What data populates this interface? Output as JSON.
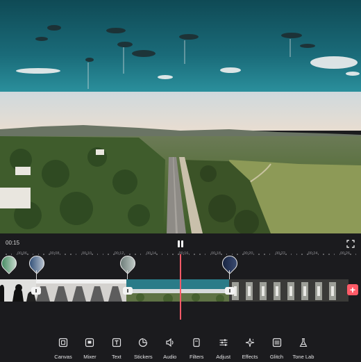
{
  "player": {
    "current_time": "00:15",
    "state": "paused"
  },
  "ruler": {
    "labels": [
      "00:06",
      "00:08",
      "00:10",
      "00:12",
      "00:14",
      "00:16",
      "00:18",
      "00:20",
      "00:22",
      "00:24",
      "00:26"
    ]
  },
  "timeline": {
    "markers": [
      "effect-marker-1",
      "effect-marker-2",
      "effect-marker-3",
      "effect-marker-4"
    ]
  },
  "toolbar": {
    "items": [
      {
        "label": "Canvas",
        "icon": "canvas-icon"
      },
      {
        "label": "Mixer",
        "icon": "mixer-icon"
      },
      {
        "label": "Text",
        "icon": "text-icon"
      },
      {
        "label": "Stickers",
        "icon": "stickers-icon"
      },
      {
        "label": "Audio",
        "icon": "audio-icon"
      },
      {
        "label": "Filters",
        "icon": "filters-icon"
      },
      {
        "label": "Adjust",
        "icon": "adjust-icon"
      },
      {
        "label": "Effects",
        "icon": "effects-icon"
      },
      {
        "label": "Glitch",
        "icon": "glitch-icon"
      },
      {
        "label": "Tone Lab",
        "icon": "tone-lab-icon"
      }
    ]
  },
  "add_clip": "+",
  "colors": {
    "accent": "#ff5a67",
    "background": "#1b1b1e"
  }
}
